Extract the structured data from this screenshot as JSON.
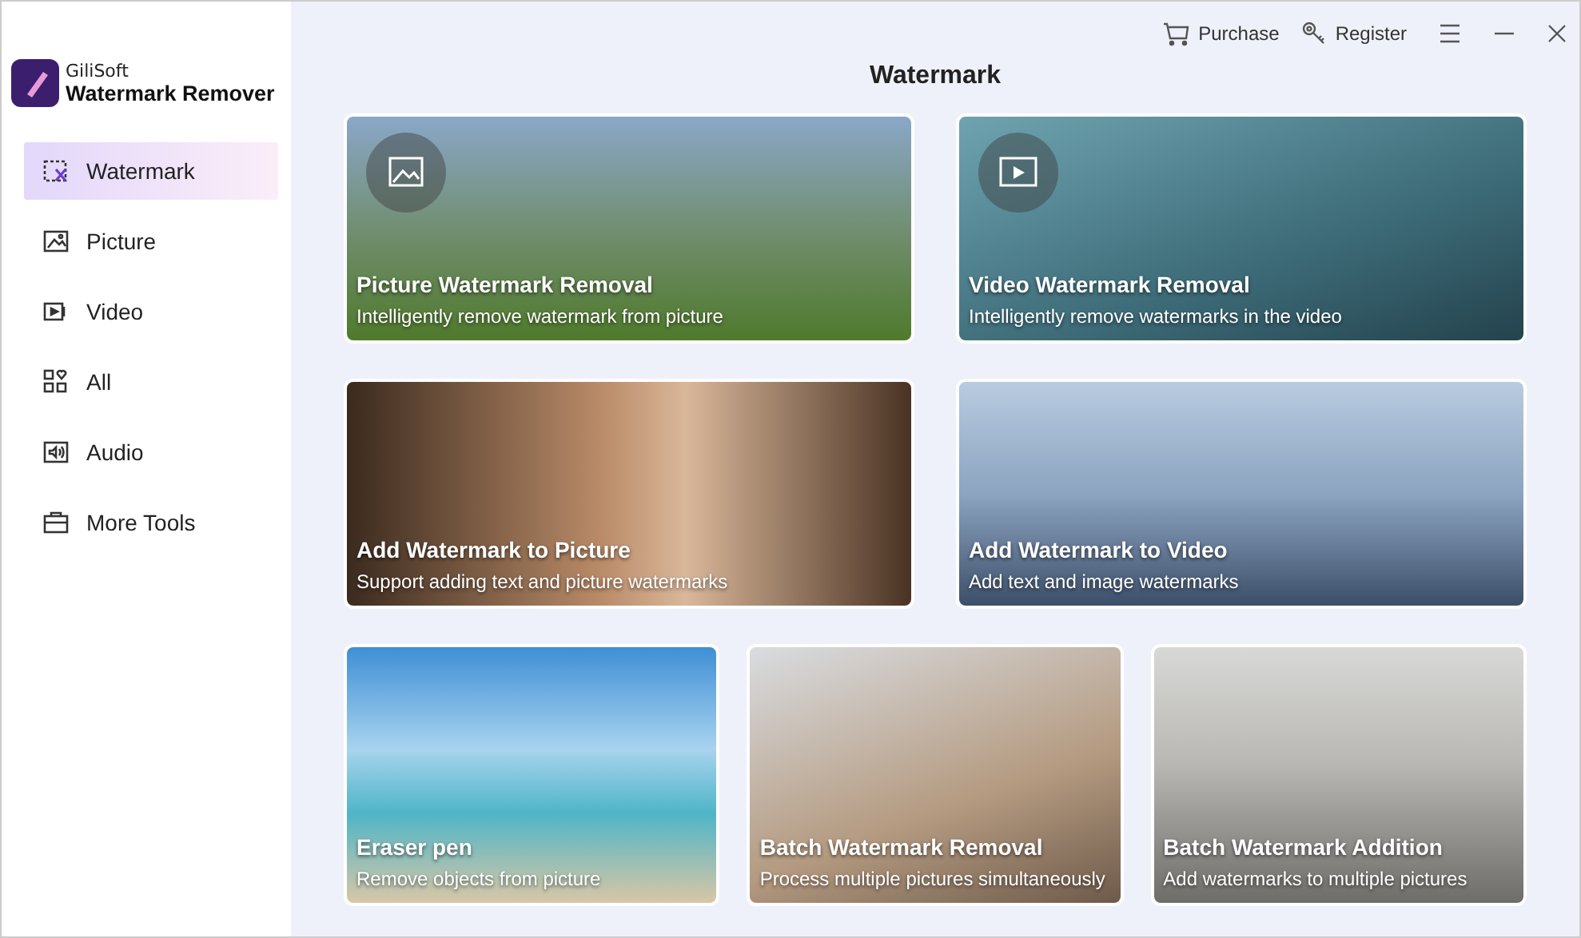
{
  "app": {
    "vendor": "GiliSoft",
    "name": "Watermark Remover"
  },
  "sidebar": {
    "items": [
      {
        "label": "Watermark",
        "selected": true
      },
      {
        "label": "Picture",
        "selected": false
      },
      {
        "label": "Video",
        "selected": false
      },
      {
        "label": "All",
        "selected": false
      },
      {
        "label": "Audio",
        "selected": false
      },
      {
        "label": "More Tools",
        "selected": false
      }
    ]
  },
  "top_bar": {
    "purchase": "Purchase",
    "register": "Register"
  },
  "page_title": "Watermark",
  "card_rows": [
    [
      {
        "title": "Picture Watermark Removal",
        "subtitle": "Intelligently remove watermark from picture"
      },
      {
        "title": "Video Watermark Removal",
        "subtitle": "Intelligently remove watermarks in the video"
      }
    ],
    [
      {
        "title": "Add Watermark to Picture",
        "subtitle": "Support adding text and picture watermarks"
      },
      {
        "title": "Add Watermark to Video",
        "subtitle": "Add text and image watermarks"
      }
    ],
    [
      {
        "title": "Eraser pen",
        "subtitle": "Remove objects from picture"
      },
      {
        "title": "Batch Watermark Removal",
        "subtitle": "Process multiple pictures simultaneously"
      },
      {
        "title": "Batch Watermark Addition",
        "subtitle": "Add watermarks to multiple pictures"
      }
    ]
  ]
}
